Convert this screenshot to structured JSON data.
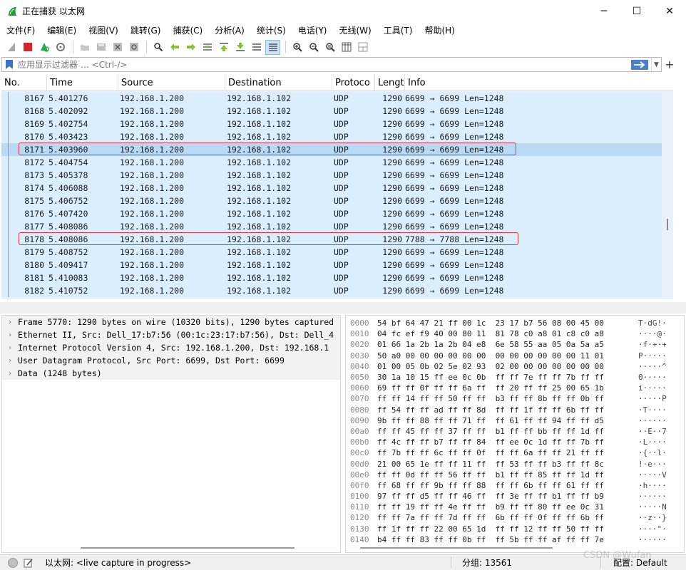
{
  "window": {
    "title": "正在捕获 以太网",
    "minimize": "─",
    "maximize": "☐",
    "close": "✕"
  },
  "menu": [
    "文件(F)",
    "编辑(E)",
    "视图(V)",
    "跳转(G)",
    "捕获(C)",
    "分析(A)",
    "统计(S)",
    "电话(Y)",
    "无线(W)",
    "工具(T)",
    "帮助(H)"
  ],
  "toolbar": {
    "icons": [
      "shark-fin-icon",
      "stop-icon",
      "restart-icon",
      "options-gear-icon",
      "open-icon",
      "save-icon",
      "close-file-icon",
      "reload-icon",
      "find-icon",
      "back-icon",
      "forward-icon",
      "go-to-icon",
      "first-icon",
      "last-icon",
      "autoscroll-icon",
      "colorize-icon",
      "zoom-in-icon",
      "zoom-out-icon",
      "normal-size-icon",
      "resize-columns-icon",
      "layout-icon"
    ]
  },
  "filter": {
    "placeholder": "应用显示过滤器 … <Ctrl-/>",
    "plus": "+"
  },
  "packet_list": {
    "columns": [
      "No.",
      "Time",
      "Source",
      "Destination",
      "Protoco",
      "Lengt",
      "Info"
    ],
    "rows": [
      {
        "no": "8167",
        "time": "5.401276",
        "src": "192.168.1.200",
        "dst": "192.168.1.102",
        "proto": "UDP",
        "len": "1290",
        "info": "6699 → 6699 Len=1248"
      },
      {
        "no": "8168",
        "time": "5.402092",
        "src": "192.168.1.200",
        "dst": "192.168.1.102",
        "proto": "UDP",
        "len": "1290",
        "info": "6699 → 6699 Len=1248"
      },
      {
        "no": "8169",
        "time": "5.402754",
        "src": "192.168.1.200",
        "dst": "192.168.1.102",
        "proto": "UDP",
        "len": "1290",
        "info": "6699 → 6699 Len=1248"
      },
      {
        "no": "8170",
        "time": "5.403423",
        "src": "192.168.1.200",
        "dst": "192.168.1.102",
        "proto": "UDP",
        "len": "1290",
        "info": "6699 → 6699 Len=1248"
      },
      {
        "no": "8171",
        "time": "5.403960",
        "src": "192.168.1.200",
        "dst": "192.168.1.102",
        "proto": "UDP",
        "len": "1290",
        "info": "6699 → 6699 Len=1248"
      },
      {
        "no": "8172",
        "time": "5.404754",
        "src": "192.168.1.200",
        "dst": "192.168.1.102",
        "proto": "UDP",
        "len": "1290",
        "info": "6699 → 6699 Len=1248"
      },
      {
        "no": "8173",
        "time": "5.405378",
        "src": "192.168.1.200",
        "dst": "192.168.1.102",
        "proto": "UDP",
        "len": "1290",
        "info": "6699 → 6699 Len=1248"
      },
      {
        "no": "8174",
        "time": "5.406088",
        "src": "192.168.1.200",
        "dst": "192.168.1.102",
        "proto": "UDP",
        "len": "1290",
        "info": "6699 → 6699 Len=1248"
      },
      {
        "no": "8175",
        "time": "5.406752",
        "src": "192.168.1.200",
        "dst": "192.168.1.102",
        "proto": "UDP",
        "len": "1290",
        "info": "6699 → 6699 Len=1248"
      },
      {
        "no": "8176",
        "time": "5.407420",
        "src": "192.168.1.200",
        "dst": "192.168.1.102",
        "proto": "UDP",
        "len": "1290",
        "info": "6699 → 6699 Len=1248"
      },
      {
        "no": "8177",
        "time": "5.408086",
        "src": "192.168.1.200",
        "dst": "192.168.1.102",
        "proto": "UDP",
        "len": "1290",
        "info": "6699 → 6699 Len=1248"
      },
      {
        "no": "8178",
        "time": "5.408086",
        "src": "192.168.1.200",
        "dst": "192.168.1.102",
        "proto": "UDP",
        "len": "1290",
        "info": "7788 → 7788 Len=1248"
      },
      {
        "no": "8179",
        "time": "5.408752",
        "src": "192.168.1.200",
        "dst": "192.168.1.102",
        "proto": "UDP",
        "len": "1290",
        "info": "6699 → 6699 Len=1248"
      },
      {
        "no": "8180",
        "time": "5.409417",
        "src": "192.168.1.200",
        "dst": "192.168.1.102",
        "proto": "UDP",
        "len": "1290",
        "info": "6699 → 6699 Len=1248"
      },
      {
        "no": "8181",
        "time": "5.410083",
        "src": "192.168.1.200",
        "dst": "192.168.1.102",
        "proto": "UDP",
        "len": "1290",
        "info": "6699 → 6699 Len=1248"
      },
      {
        "no": "8182",
        "time": "5.410752",
        "src": "192.168.1.200",
        "dst": "192.168.1.102",
        "proto": "UDP",
        "len": "1290",
        "info": "6699 → 6699 Len=1248"
      }
    ],
    "selected_no": "8171",
    "highlighted_no": [
      "8171",
      "8178"
    ],
    "highlight_color": "#e0344a",
    "row_color": "#daeefe",
    "selected_color": "#b9d9f5"
  },
  "details": [
    "Frame 5770: 1290 bytes on wire (10320 bits), 1290 bytes captured",
    "Ethernet II, Src: Dell_17:b7:56 (00:1c:23:17:b7:56), Dst: Dell_4",
    "Internet Protocol Version 4, Src: 192.168.1.200, Dst: 192.168.1",
    "User Datagram Protocol, Src Port: 6699, Dst Port: 6699",
    "Data (1248 bytes)"
  ],
  "bytes": [
    {
      "off": "0000",
      "hex": "54 bf 64 47 21 ff 00 1c  23 17 b7 56 08 00 45 00",
      "asc": "T·dG!·"
    },
    {
      "off": "0010",
      "hex": "04 fc ef f9 40 00 80 11  81 78 c0 a8 01 c8 c0 a8",
      "asc": "····@·"
    },
    {
      "off": "0020",
      "hex": "01 66 1a 2b 1a 2b 04 e8  6e 58 55 aa 05 0a 5a a5",
      "asc": "·f·+·+"
    },
    {
      "off": "0030",
      "hex": "50 a0 00 00 00 00 00 00  00 00 00 00 00 00 11 01",
      "asc": "P·····"
    },
    {
      "off": "0040",
      "hex": "01 00 05 0b 02 5e 02 93  02 00 00 00 00 00 00 00",
      "asc": "·····^"
    },
    {
      "off": "0050",
      "hex": "30 1a 10 15 ff ee 0c 0b  ff ff 7e ff ff 7b ff ff",
      "asc": "0·····"
    },
    {
      "off": "0060",
      "hex": "69 ff ff 0f ff ff 6a ff  ff 20 ff ff 25 00 65 1b",
      "asc": "i·····"
    },
    {
      "off": "0070",
      "hex": "ff ff 14 ff ff 50 ff ff  b3 ff ff 8b ff ff 0b ff",
      "asc": "·····P"
    },
    {
      "off": "0080",
      "hex": "ff 54 ff ff ad ff ff 8d  ff ff 1f ff ff 6b ff ff",
      "asc": "·T····"
    },
    {
      "off": "0090",
      "hex": "9b ff ff 88 ff ff 71 ff  ff 61 ff ff 94 ff ff d5",
      "asc": "······"
    },
    {
      "off": "00a0",
      "hex": "ff ff 45 ff ff 37 ff ff  b1 ff ff bb ff ff 1d ff",
      "asc": "··E··7"
    },
    {
      "off": "00b0",
      "hex": "ff 4c ff ff b7 ff ff 84  ff ee 0c 1d ff ff 7b ff",
      "asc": "·L····"
    },
    {
      "off": "00c0",
      "hex": "ff 7b ff ff 6c ff ff 0f  ff ff 6a ff ff 21 ff ff",
      "asc": "·{··l·"
    },
    {
      "off": "00d0",
      "hex": "21 00 65 1e ff ff 11 ff  ff 53 ff ff b3 ff ff 8c",
      "asc": "!·e···"
    },
    {
      "off": "00e0",
      "hex": "ff ff 0d ff ff 56 ff ff  b1 ff ff 85 ff ff 1d ff",
      "asc": "·····V"
    },
    {
      "off": "00f0",
      "hex": "ff 68 ff ff 9b ff ff 88  ff ff 6b ff ff 61 ff ff",
      "asc": "·h····"
    },
    {
      "off": "0100",
      "hex": "97 ff ff d5 ff ff 46 ff  ff 3e ff ff b1 ff ff b9",
      "asc": "······"
    },
    {
      "off": "0110",
      "hex": "ff ff 19 ff ff 4e ff ff  b9 ff ff 80 ff ee 0c 31",
      "asc": "·····N"
    },
    {
      "off": "0120",
      "hex": "ff ff 7a ff ff 7d ff ff  6b ff ff 0f ff ff 6b ff",
      "asc": "··z··}"
    },
    {
      "off": "0130",
      "hex": "ff 1f ff ff 22 00 65 1d  ff ff 12 ff ff 50 ff ff",
      "asc": "····\"·"
    },
    {
      "off": "0140",
      "hex": "b4 ff ff 83 ff ff 0b ff  ff 5b ff ff af ff ff 7e",
      "asc": "······"
    }
  ],
  "status": {
    "interface": "以太网: <live capture in progress>",
    "packets": "分组: 13561",
    "profile": "配置: Default",
    "watermark": "CSDN @Wufan"
  }
}
